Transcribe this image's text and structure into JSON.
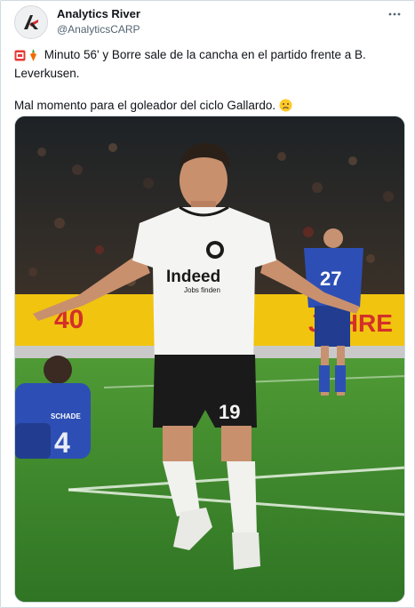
{
  "author": {
    "display_name": "Analytics River",
    "handle": "@AnalyticsCARP",
    "avatar_icon": "river-arrow-logo-icon"
  },
  "tweet": {
    "line1": "Minuto 56' y Borre sale de la cancha en el partido frente a B. Leverkusen.",
    "line2": "Mal momento para el goleador del ciclo Gallardo.",
    "leading_emojis": [
      "stadium-icon",
      "carrot-icon"
    ],
    "trailing_emoji": "sad-face-emoji"
  },
  "media": {
    "kind": "photo",
    "sponsor_text": "Indeed",
    "sponsor_sub": "Jobs finden",
    "shirt_number": "19",
    "opponent_number": "27",
    "opponent_name_back": "SCHADE",
    "opponent_number_sitting": "4",
    "board_text": "JAHRE",
    "board_number": "40",
    "colors": {
      "pitch": "#3f8a2e",
      "board_yellow": "#f1c40f",
      "kit_white": "#f4f4f2",
      "kit_black": "#1a1a1a",
      "opponent_blue": "#2d4fb5"
    }
  },
  "ui": {
    "more_icon": "more-dots-icon"
  }
}
